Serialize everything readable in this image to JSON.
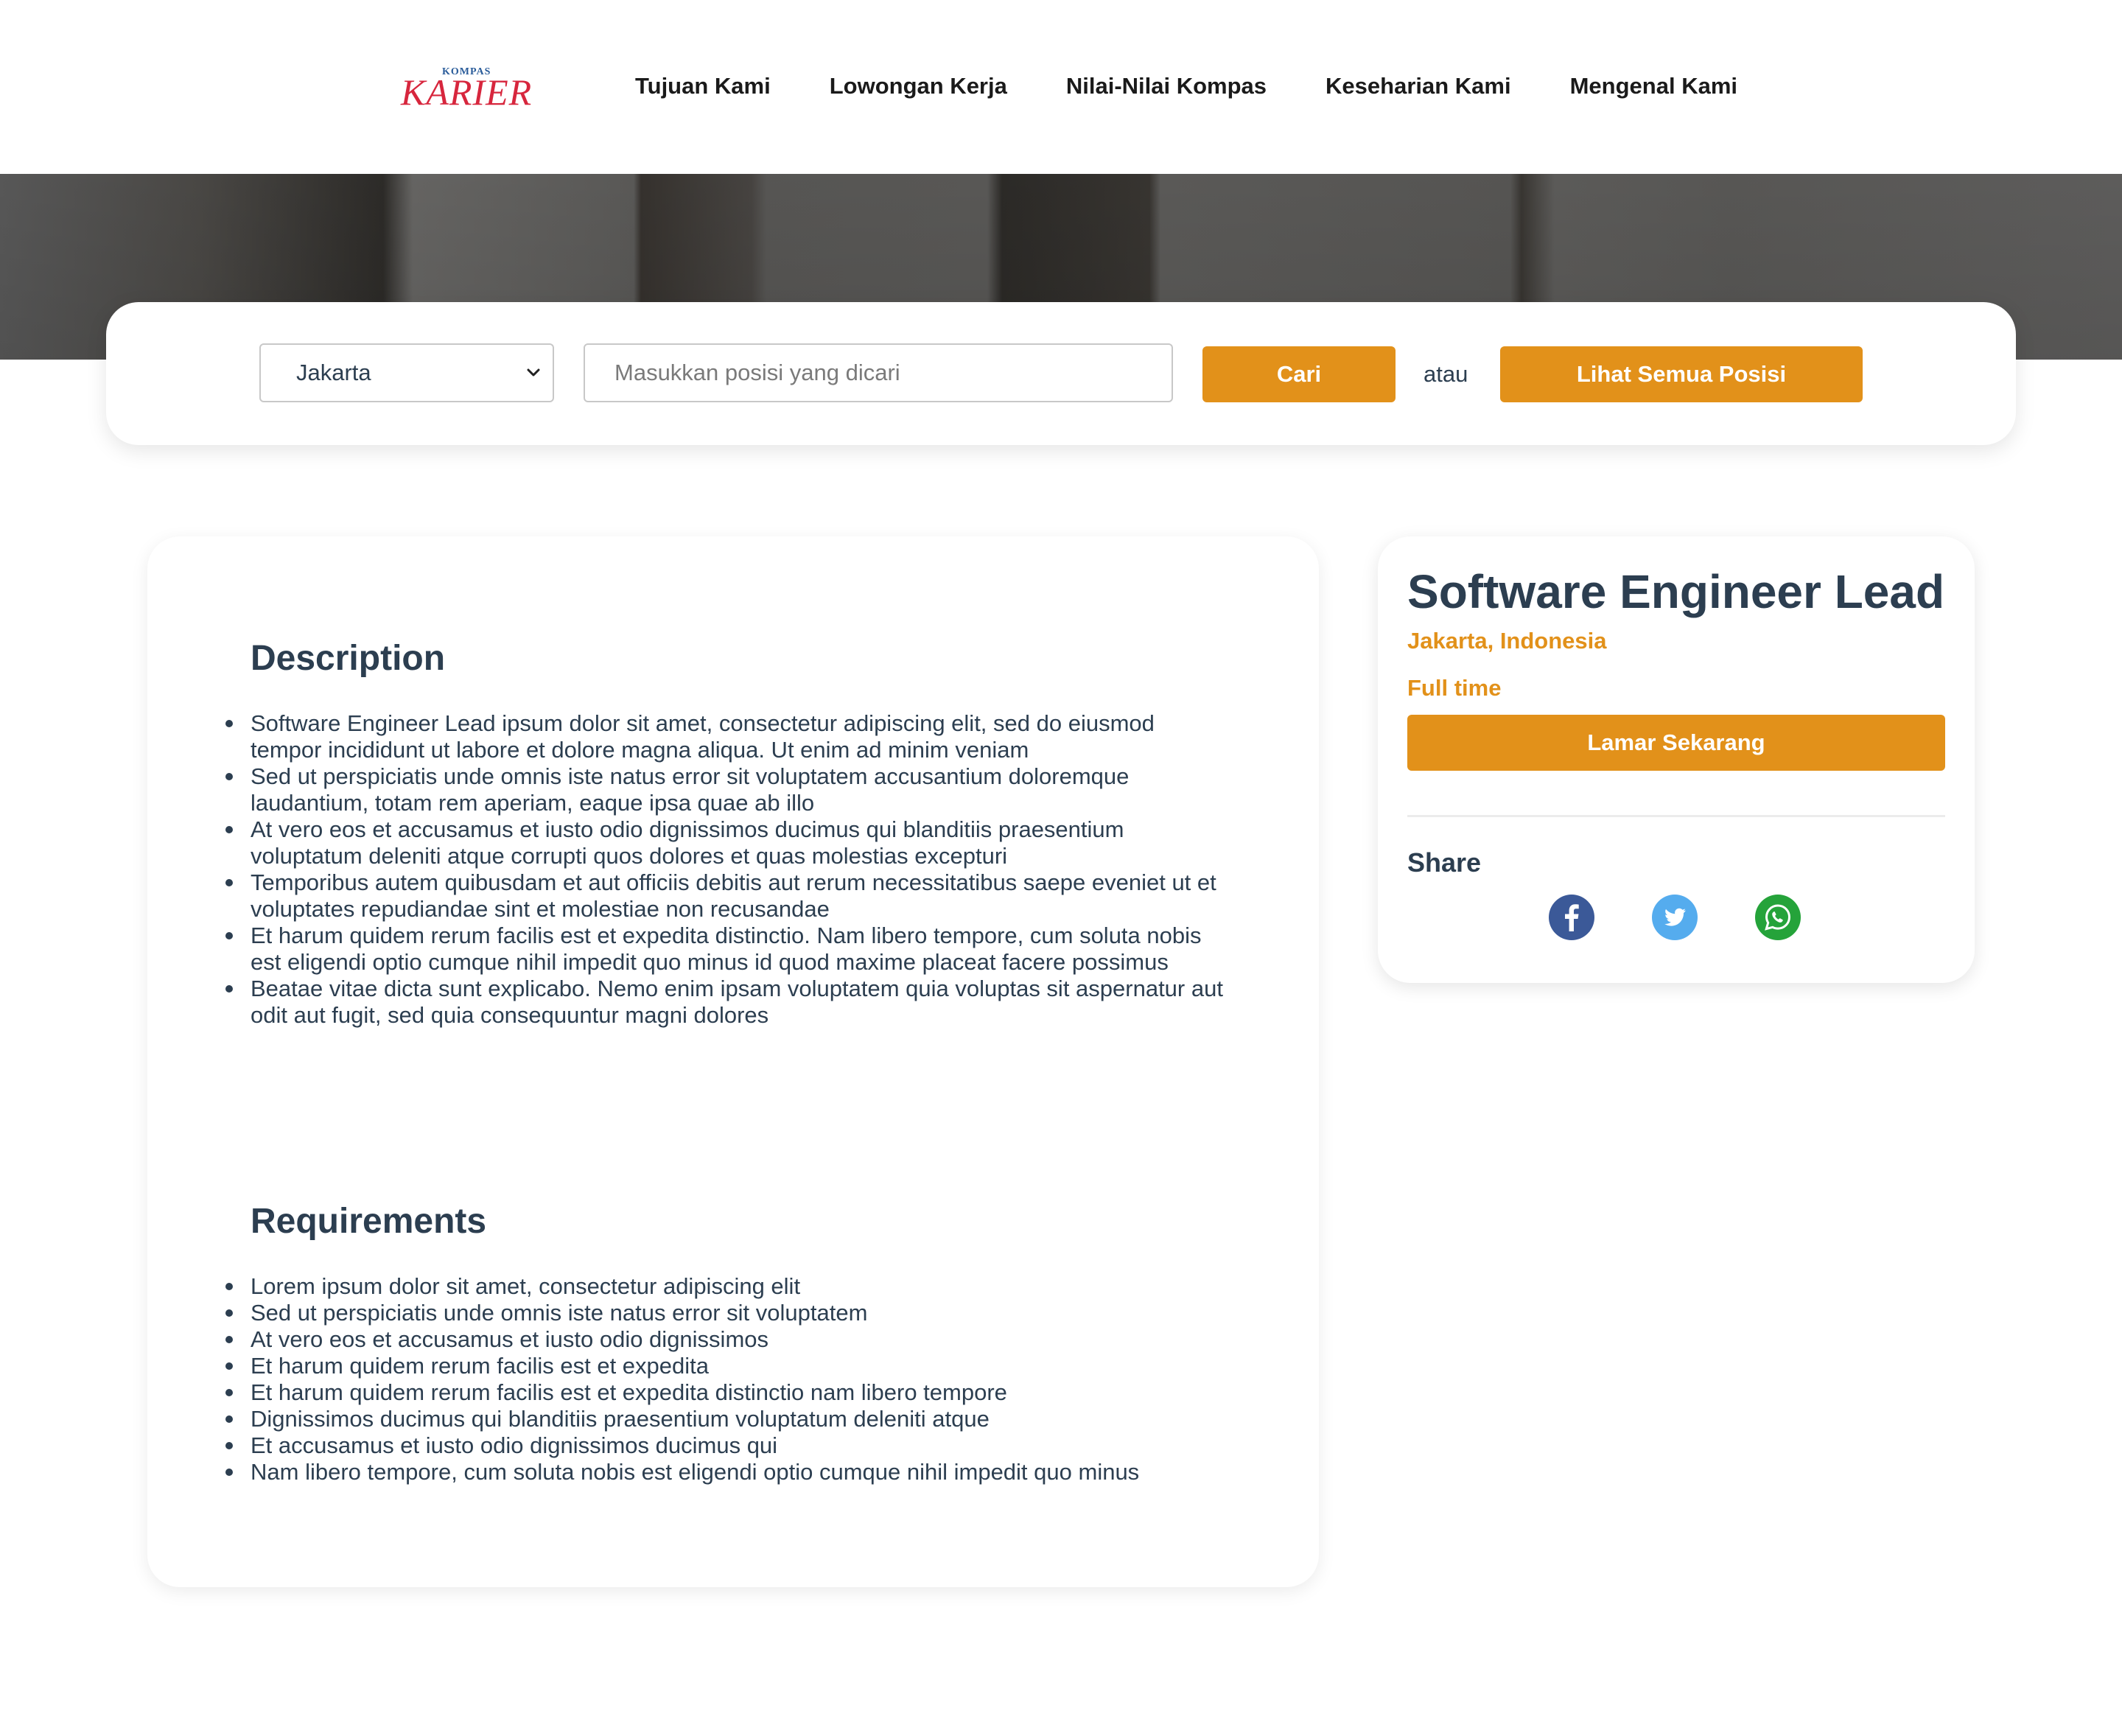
{
  "brand": {
    "logo_top": "KOMPAS",
    "logo_main": "KARIER"
  },
  "nav": {
    "items": [
      "Tujuan Kami",
      "Lowongan Kerja",
      "Nilai-Nilai Kompas",
      "Keseharian Kami",
      "Mengenal Kami"
    ]
  },
  "search": {
    "location_selected": "Jakarta",
    "position_placeholder": "Masukkan posisi yang dicari",
    "search_label": "Cari",
    "or_label": "atau",
    "all_positions_label": "Lihat Semua Posisi"
  },
  "description": {
    "title": "Description",
    "items": [
      "Software Engineer Lead ipsum dolor sit amet, consectetur adipiscing elit, sed do eiusmod tempor incididunt ut labore et dolore magna aliqua. Ut enim ad minim veniam",
      "Sed ut perspiciatis unde omnis iste natus error sit voluptatem accusantium doloremque laudantium, totam rem aperiam, eaque ipsa quae ab illo",
      "At vero eos et accusamus et iusto odio dignissimos ducimus qui blanditiis praesentium voluptatum deleniti atque corrupti quos dolores et quas molestias excepturi",
      "Temporibus autem quibusdam et aut officiis debitis aut rerum necessitatibus saepe eveniet ut et voluptates repudiandae sint et molestiae non recusandae",
      "Et harum quidem rerum facilis est et expedita distinctio. Nam libero tempore, cum soluta nobis est eligendi optio cumque nihil impedit quo minus id quod maxime placeat facere possimus",
      "Beatae vitae dicta sunt explicabo. Nemo enim ipsam voluptatem quia voluptas sit aspernatur aut odit aut fugit, sed quia consequuntur magni dolores"
    ]
  },
  "requirements": {
    "title": "Requirements",
    "items": [
      "Lorem ipsum dolor sit amet, consectetur adipiscing elit",
      "Sed ut perspiciatis unde omnis iste natus error sit voluptatem",
      "At vero eos et accusamus et iusto odio dignissimos",
      "Et harum quidem rerum facilis est et expedita",
      "Et harum quidem rerum facilis est et expedita distinctio nam libero tempore",
      "Dignissimos ducimus qui blanditiis praesentium voluptatum deleniti atque",
      "Et accusamus et iusto odio dignissimos ducimus qui",
      "Nam libero tempore, cum soluta nobis est eligendi optio cumque nihil impedit quo minus"
    ]
  },
  "job": {
    "title": "Software Engineer Lead",
    "location": "Jakarta, Indonesia",
    "type": "Full time",
    "apply_label": "Lamar Sekarang",
    "share_label": "Share",
    "share_icons": [
      "facebook-icon",
      "twitter-icon",
      "whatsapp-icon"
    ]
  },
  "colors": {
    "accent": "#e2911a",
    "text": "#2c3e50",
    "logo": "#d7263d",
    "facebook": "#3b5998",
    "twitter": "#55acee",
    "whatsapp": "#25a33a"
  }
}
